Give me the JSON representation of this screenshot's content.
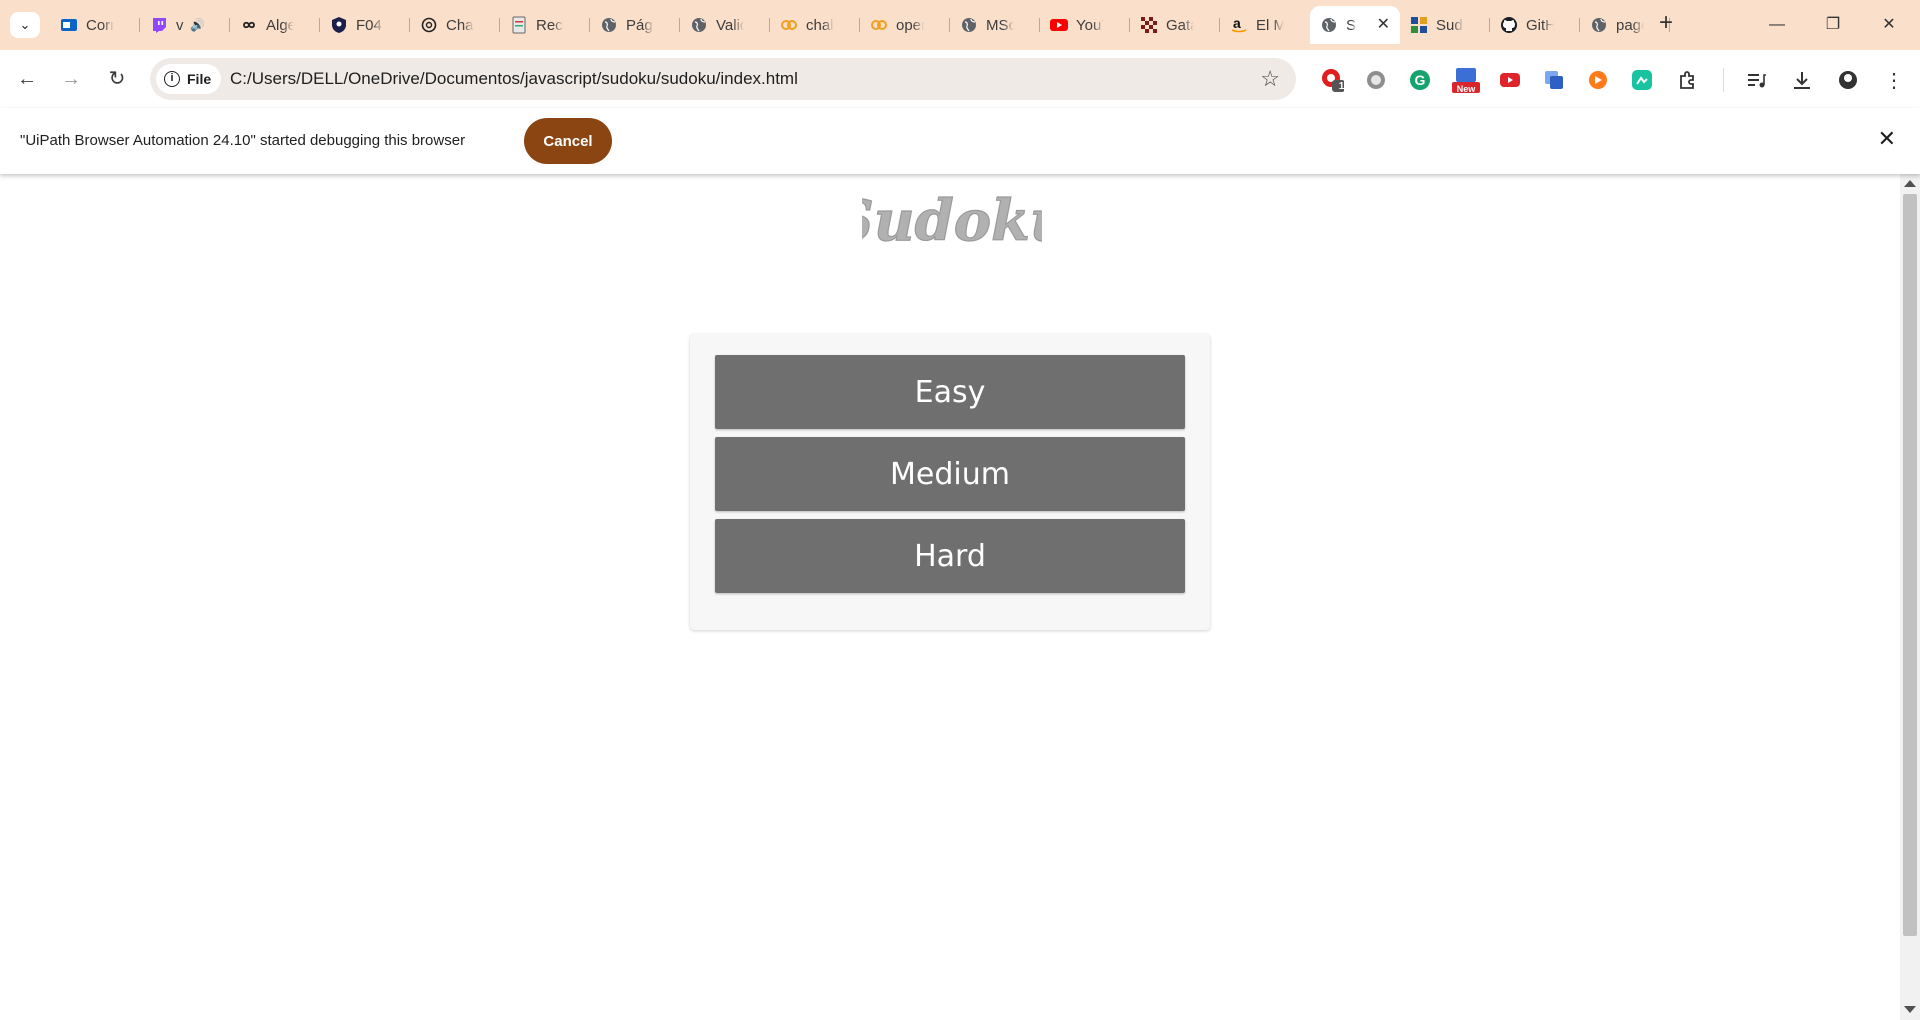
{
  "tabs": [
    {
      "title": "Correo",
      "icon": "outlook-icon"
    },
    {
      "title": "v",
      "icon": "twitch-icon",
      "audio": "🔊"
    },
    {
      "title": "Algebra",
      "icon": "infinity-icon"
    },
    {
      "title": "F04",
      "icon": "shield-icon"
    },
    {
      "title": "ChatGPT",
      "icon": "openai-icon"
    },
    {
      "title": "Recibo",
      "icon": "document-icon"
    },
    {
      "title": "Página",
      "icon": "globe-icon"
    },
    {
      "title": "Validar",
      "icon": "globe-icon"
    },
    {
      "title": "challenge",
      "icon": "codewars-icon"
    },
    {
      "title": "operators",
      "icon": "codewars-icon"
    },
    {
      "title": "MSci",
      "icon": "globe-icon"
    },
    {
      "title": "YouTube",
      "icon": "youtube-icon"
    },
    {
      "title": "Gatas",
      "icon": "checker-icon"
    },
    {
      "title": "El M",
      "icon": "amazon-icon"
    },
    {
      "title": "Sudoku",
      "icon": "globe-icon",
      "active": true
    },
    {
      "title": "Sudoku",
      "icon": "grid-icon"
    },
    {
      "title": "GitHub",
      "icon": "github-icon"
    },
    {
      "title": "page",
      "icon": "globe-icon"
    }
  ],
  "toolbar": {
    "chip_label": "File",
    "url": "C:/Users/DELL/OneDrive/Documentos/javascript/sudoku/sudoku/index.html",
    "extension_badge_count": "1",
    "extension_badge_new": "New"
  },
  "infobar": {
    "message": "\"UiPath Browser Automation 24.10\" started debugging this browser",
    "cancel_label": "Cancel"
  },
  "page": {
    "logo_text": "Sudoku",
    "levels": [
      "Easy",
      "Medium",
      "Hard"
    ]
  },
  "colors": {
    "tabstrip": "#fadfcb",
    "cancel_button": "#8b4513",
    "level_button": "#6f6f6f",
    "logo": "#b1b1b1"
  }
}
